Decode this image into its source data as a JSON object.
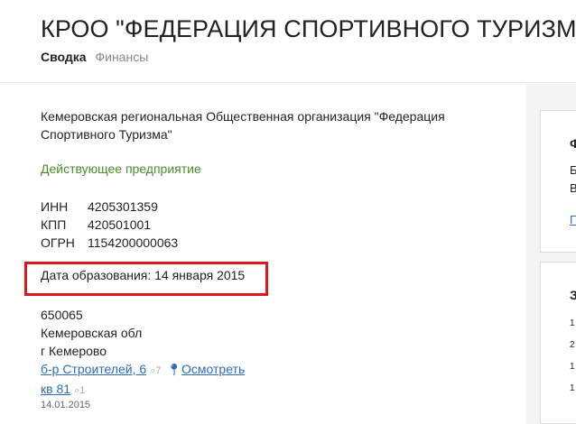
{
  "header": {
    "title": "КРОО \"ФЕДЕРАЦИЯ СПОРТИВНОГО ТУРИЗМА\"",
    "tabs": [
      {
        "label": "Сводка",
        "active": true
      },
      {
        "label": "Финансы",
        "active": false
      }
    ]
  },
  "main": {
    "full_name": "Кемеровская региональная Общественная организация \"Федерация Спортивного Туризма\"",
    "status": "Действующее предприятие",
    "codes": [
      {
        "label": "ИНН",
        "value": "4205301359"
      },
      {
        "label": "КПП",
        "value": "420501001"
      },
      {
        "label": "ОГРН",
        "value": "1154200000063"
      }
    ],
    "registration": "Дата образования: 14 января 2015",
    "address": {
      "postal_code": "650065",
      "region": "Кемеровская обл",
      "city": "г Кемерово",
      "street": "б-р Строителей, 6",
      "street_count": "7",
      "view_link": "Осмотреть",
      "apartment": "кв 81",
      "apartment_count": "1",
      "date": "14.01.2015"
    }
  },
  "sidebar": {
    "card1": {
      "heading": "Ф",
      "line1": "Б",
      "line2": "В",
      "link": "П"
    },
    "card2": {
      "heading": "З",
      "rows": [
        "1",
        "2",
        "1",
        "1"
      ]
    }
  },
  "colors": {
    "status_green": "#4a8b2a",
    "link_blue": "#2d6bb7",
    "highlight_red": "#e01818"
  }
}
